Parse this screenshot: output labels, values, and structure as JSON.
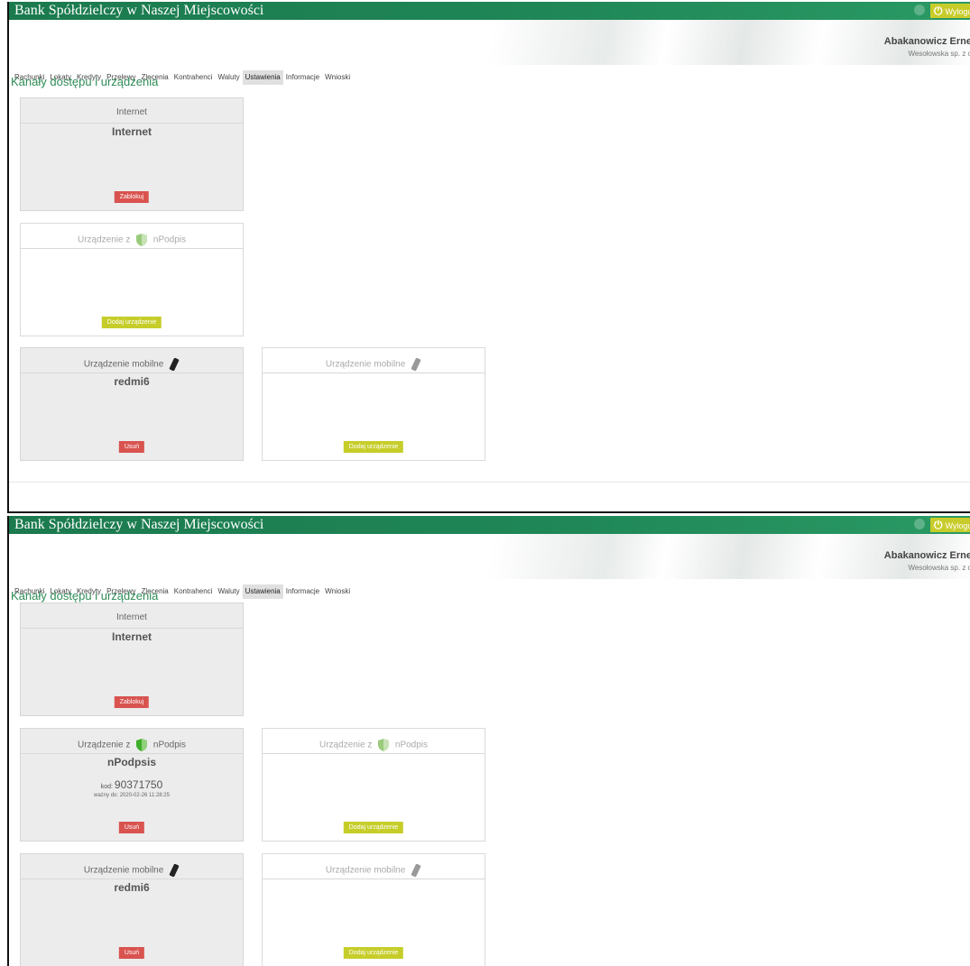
{
  "bank_title": "Bank Spółdzielczy w Naszej Miejscowości",
  "logout_label": "Wyloguj",
  "user": {
    "name": "Abakanowicz Erne",
    "company": "Wesołowska sp. z o"
  },
  "menu": [
    "Rachunki",
    "Lokaty",
    "Kredyty",
    "Przelewy",
    "Zlecenia",
    "Kontrahenci",
    "Waluty",
    "Ustawienia",
    "Informacje",
    "Wnioski"
  ],
  "page_title": "Kanały dostępu i urządzenia",
  "cards": {
    "internet_header": "Internet",
    "internet_name": "Internet",
    "block_button": "Zablokuj",
    "npodpis_header_prefix": "Urządzenie z",
    "npodpis_header_suffix": "nPodpis",
    "npodpis_name": "nPodpsis",
    "npodpis_code_label": "kod:",
    "npodpis_code": "90371750",
    "npodpis_valid": "ważny do: 2020-02-26 11:28:25",
    "mobile_header": "Urządzenie mobilne",
    "mobile_name": "redmi6",
    "add_button": "Dodaj urządzenie",
    "delete_button": "Usuń"
  }
}
